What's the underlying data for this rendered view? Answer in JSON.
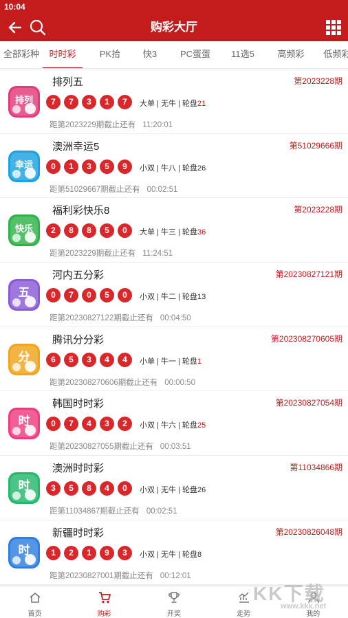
{
  "status_bar": {
    "time": "10:04"
  },
  "header": {
    "title": "购彩大厅"
  },
  "tabs": [
    {
      "label": "全部彩种",
      "active": false
    },
    {
      "label": "时时彩",
      "active": true
    },
    {
      "label": "PK拾",
      "active": false
    },
    {
      "label": "快3",
      "active": false
    },
    {
      "label": "PC蛋蛋",
      "active": false
    },
    {
      "label": "11选5",
      "active": false
    },
    {
      "label": "高频彩",
      "active": false
    },
    {
      "label": "低频彩",
      "active": false
    }
  ],
  "games": [
    {
      "name": "排列五",
      "issue": "第2023228期",
      "balls": [
        "7",
        "7",
        "3",
        "1",
        "7"
      ],
      "attr1": "大单",
      "attr2": "无牛",
      "wheel_label": "轮盘",
      "wheel_value": "21",
      "wheel_highlight": true,
      "next_text": "距第2023229期截止还有",
      "countdown": "11:20:01",
      "logo_text": "排列",
      "logo_color": "#e23b7a"
    },
    {
      "name": "澳洲幸运5",
      "issue": "第51029666期",
      "balls": [
        "0",
        "1",
        "3",
        "5",
        "9"
      ],
      "attr1": "小双",
      "attr2": "牛八",
      "wheel_label": "轮盘",
      "wheel_value": "26",
      "wheel_highlight": false,
      "next_text": "距第51029667期截止还有",
      "countdown": "00:02:51",
      "logo_text": "幸运",
      "logo_color": "#1aa3e0"
    },
    {
      "name": "福利彩快乐8",
      "issue": "第2023228期",
      "balls": [
        "2",
        "8",
        "8",
        "5",
        "0"
      ],
      "attr1": "大单",
      "attr2": "牛三",
      "wheel_label": "轮盘",
      "wheel_value": "36",
      "wheel_highlight": true,
      "next_text": "距第2023229期截止还有",
      "countdown": "11:24:51",
      "logo_text": "快乐",
      "logo_color": "#2fb24a"
    },
    {
      "name": "河内五分彩",
      "issue": "第20230827121期",
      "balls": [
        "0",
        "7",
        "0",
        "5",
        "0"
      ],
      "attr1": "小双",
      "attr2": "牛二",
      "wheel_label": "轮盘",
      "wheel_value": "13",
      "wheel_highlight": false,
      "next_text": "距第20230827122期截止还有",
      "countdown": "00:04:50",
      "logo_text": "五",
      "logo_color": "#8a5bd6"
    },
    {
      "name": "腾讯分分彩",
      "issue": "第20230827060​5期",
      "balls": [
        "6",
        "5",
        "3",
        "4",
        "4"
      ],
      "attr1": "小单",
      "attr2": "牛一",
      "wheel_label": "轮盘",
      "wheel_value": "1",
      "wheel_highlight": true,
      "next_text": "距第202308270606期截止还有",
      "countdown": "00:00:50",
      "logo_text": "分",
      "logo_color": "#f0a51c"
    },
    {
      "name": "韩国时时彩",
      "issue": "第20230827054期",
      "balls": [
        "0",
        "7",
        "4",
        "3",
        "2"
      ],
      "attr1": "小双",
      "attr2": "牛六",
      "wheel_label": "轮盘",
      "wheel_value": "25",
      "wheel_highlight": true,
      "next_text": "距第20230827055期截止还有",
      "countdown": "00:03:51",
      "logo_text": "时",
      "logo_color": "#ef3c7f"
    },
    {
      "name": "澳洲时时彩",
      "issue": "第11034866期",
      "balls": [
        "3",
        "5",
        "8",
        "4",
        "0"
      ],
      "attr1": "小双",
      "attr2": "无牛",
      "wheel_label": "轮盘",
      "wheel_value": "26",
      "wheel_highlight": false,
      "next_text": "距第11034867期截止还有",
      "countdown": "00:02:51",
      "logo_text": "时",
      "logo_color": "#25b86c"
    },
    {
      "name": "新疆时时彩",
      "issue": "第20230826048期",
      "balls": [
        "1",
        "2",
        "1",
        "9",
        "3"
      ],
      "attr1": "小双",
      "attr2": "无牛",
      "wheel_label": "轮盘",
      "wheel_value": "8",
      "wheel_highlight": false,
      "next_text": "距第20230827001期截止还有",
      "countdown": "00:12:01",
      "logo_text": "时",
      "logo_color": "#2f7fe0"
    }
  ],
  "bottom_nav": [
    {
      "label": "首页",
      "icon": "home-icon",
      "active": false
    },
    {
      "label": "购彩",
      "icon": "cart-icon",
      "active": true
    },
    {
      "label": "开奖",
      "icon": "trophy-icon",
      "active": false
    },
    {
      "label": "走势",
      "icon": "trend-chart-icon",
      "active": false
    },
    {
      "label": "我的",
      "icon": "user-icon",
      "active": false
    }
  ],
  "watermark": {
    "text": "KK下载",
    "url": "www.kkx.net"
  },
  "colors": {
    "brand_red": "#c41b1c",
    "ball_red": "#d9272b"
  }
}
